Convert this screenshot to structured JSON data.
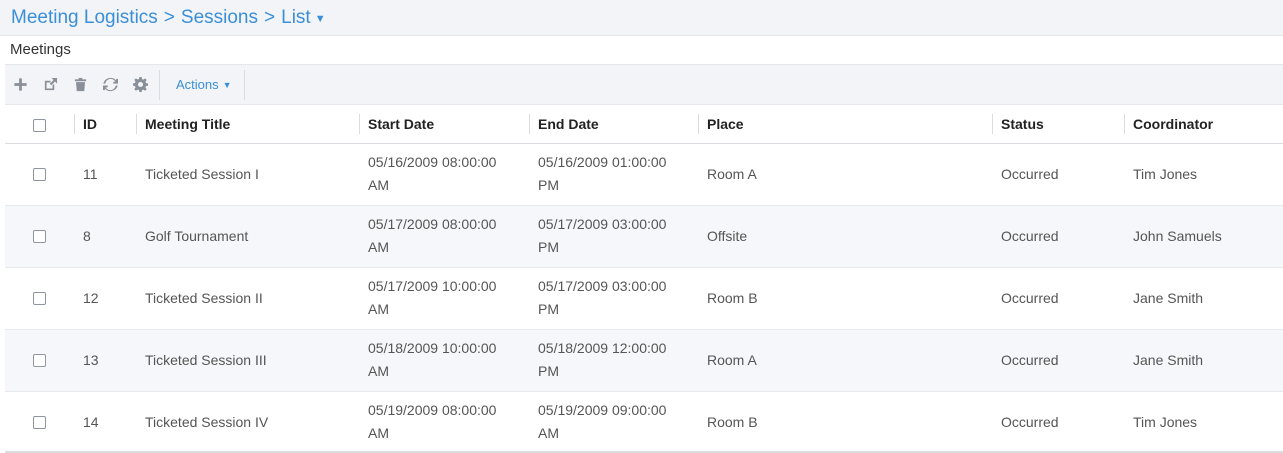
{
  "breadcrumb": {
    "items": [
      "Meeting Logistics",
      ">",
      "Sessions",
      ">",
      "List"
    ]
  },
  "section": {
    "title": "Meetings"
  },
  "toolbar": {
    "icons": [
      "plus-icon",
      "external-link-icon",
      "trash-icon",
      "refresh-icon",
      "gear-icon"
    ],
    "actions_label": "Actions"
  },
  "table": {
    "headers": {
      "id": "ID",
      "title": "Meeting Title",
      "start": "Start Date",
      "end": "End Date",
      "place": "Place",
      "status": "Status",
      "coordinator": "Coordinator"
    },
    "rows": [
      {
        "id": "11",
        "title": "Ticketed Session I",
        "start_1": "05/16/2009 08:00:00",
        "start_2": "AM",
        "end_1": "05/16/2009 01:00:00",
        "end_2": "PM",
        "place": "Room A",
        "status": "Occurred",
        "coordinator": "Tim Jones"
      },
      {
        "id": "8",
        "title": "Golf Tournament",
        "start_1": "05/17/2009 08:00:00",
        "start_2": "AM",
        "end_1": "05/17/2009 03:00:00",
        "end_2": "PM",
        "place": "Offsite",
        "status": "Occurred",
        "coordinator": "John Samuels"
      },
      {
        "id": "12",
        "title": "Ticketed Session II",
        "start_1": "05/17/2009 10:00:00",
        "start_2": "AM",
        "end_1": "05/17/2009 03:00:00",
        "end_2": "PM",
        "place": "Room B",
        "status": "Occurred",
        "coordinator": "Jane Smith"
      },
      {
        "id": "13",
        "title": "Ticketed Session III",
        "start_1": "05/18/2009 10:00:00",
        "start_2": "AM",
        "end_1": "05/18/2009 12:00:00",
        "end_2": "PM",
        "place": "Room A",
        "status": "Occurred",
        "coordinator": "Jane Smith"
      },
      {
        "id": "14",
        "title": "Ticketed Session IV",
        "start_1": "05/19/2009 08:00:00",
        "start_2": "AM",
        "end_1": "05/19/2009 09:00:00",
        "end_2": "AM",
        "place": "Room B",
        "status": "Occurred",
        "coordinator": "Tim Jones"
      }
    ]
  },
  "colors": {
    "accent": "#3a8fd8",
    "toolbar_bg": "#f2f4f7",
    "alt_row": "#f5f7fa"
  }
}
